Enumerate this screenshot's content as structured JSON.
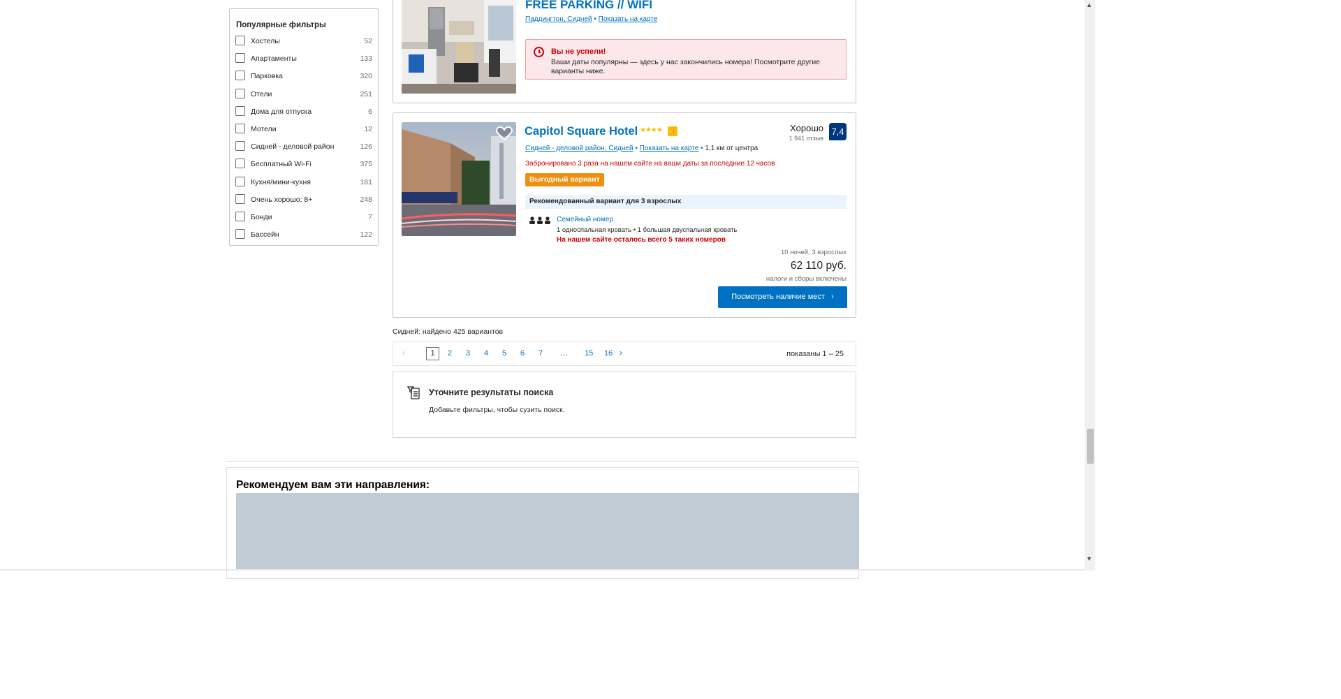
{
  "filters": {
    "title": "Популярные фильтры",
    "items": [
      {
        "label": "Хостелы",
        "count": "52"
      },
      {
        "label": "Апартаменты",
        "count": "133"
      },
      {
        "label": "Парковка",
        "count": "320"
      },
      {
        "label": "Отели",
        "count": "251"
      },
      {
        "label": "Дома для отпуска",
        "count": "6"
      },
      {
        "label": "Мотели",
        "count": "12"
      },
      {
        "label": "Сидней - деловой район",
        "count": "126"
      },
      {
        "label": "Бесплатный Wi-Fi",
        "count": "375"
      },
      {
        "label": "Кухня/мини-кухня",
        "count": "181"
      },
      {
        "label": "Очень хорошо: 8+",
        "count": "248"
      },
      {
        "label": "Бонди",
        "count": "7"
      },
      {
        "label": "Бассейн",
        "count": "122"
      }
    ]
  },
  "card1": {
    "title": "FREE PARKING // WIFI",
    "location": "Паддингтон, Сидней",
    "map_link": "Показать на карте",
    "alert_title": "Вы не успели!",
    "alert_text": "Ваши даты популярны — здесь у нас закончились номера! Посмотрите другие варианты ниже."
  },
  "card2": {
    "title": "Capitol Square Hotel",
    "stars": "★★★★",
    "location": "Сидней - деловой район, Сидней",
    "map_link": "Показать на карте",
    "distance": "1,1 км от центра",
    "booked_note": "Забронировано 3 раза на нашем сайте на ваши даты за последние 12 часов",
    "deal_badge": "Выгодный вариант",
    "recommended": "Рекомендованный вариант для 3 взрослых",
    "room_name": "Семейный номер",
    "beds": "1 односпальная кровать • 1 большая двуспальная кровать",
    "rooms_left": "На нашем сайте осталось всего 5 таких номеров",
    "score_label": "Хорошо",
    "reviews": "1 941 отзыв",
    "score": "7,4",
    "nights": "10 ночей, 3 взрослых",
    "price": "62 110 руб.",
    "taxes": "налоги и сборы включены",
    "cta": "Посмотреть наличие мест"
  },
  "results": {
    "found": "Сидней: найдено 425 вариантов",
    "pages": [
      "1",
      "2",
      "3",
      "4",
      "5",
      "6",
      "7",
      "…",
      "15",
      "16"
    ],
    "showing": "показаны 1 – 25"
  },
  "refine": {
    "title": "Уточните результаты поиска",
    "text": "Добавьте фильтры, чтобы сузить поиск."
  },
  "recommendations": {
    "title": "Рекомендуем вам эти направления:"
  },
  "colors": {
    "brand_blue": "#0071c2",
    "score_blue": "#003580",
    "deal_orange": "#ef8f0e",
    "alert_red": "#cc0000",
    "star_yellow": "#febb02"
  }
}
